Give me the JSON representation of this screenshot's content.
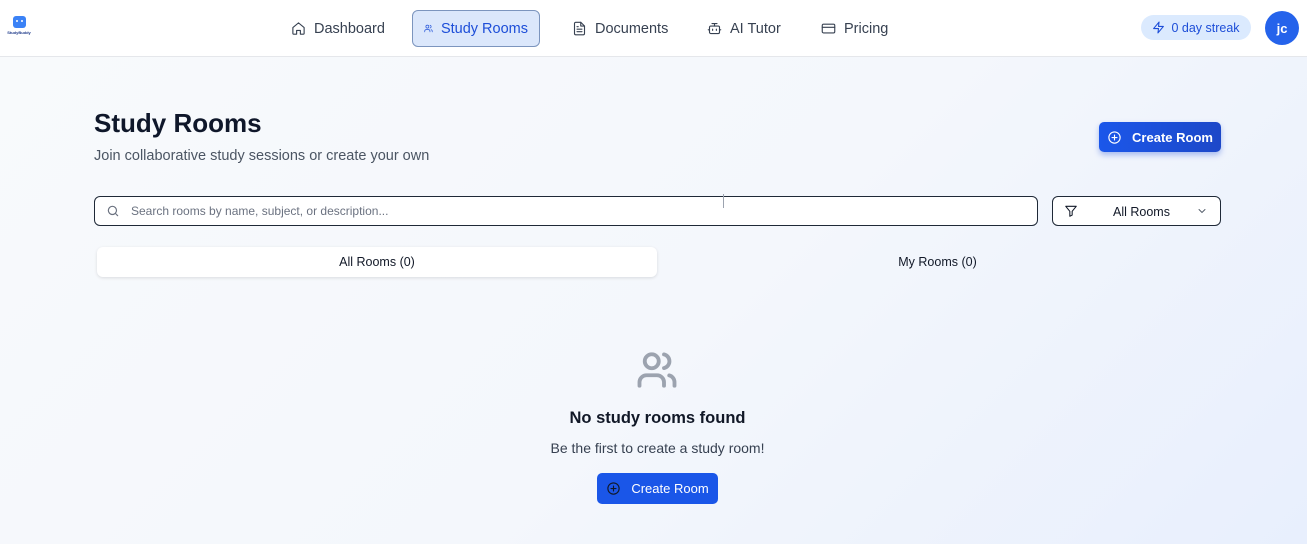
{
  "app": {
    "logo_text": "StudyBuddy"
  },
  "nav": {
    "items": [
      {
        "label": "Dashboard",
        "icon": "home-icon"
      },
      {
        "label": "Study Rooms",
        "icon": "users-icon",
        "active": true
      },
      {
        "label": "Documents",
        "icon": "file-icon"
      },
      {
        "label": "AI Tutor",
        "icon": "bot-icon"
      },
      {
        "label": "Pricing",
        "icon": "credit-card-icon"
      }
    ]
  },
  "streak": {
    "label": "0 day streak",
    "icon": "lightning-icon"
  },
  "user": {
    "initials": "jc"
  },
  "page": {
    "title": "Study Rooms",
    "subtitle": "Join collaborative study sessions or create your own",
    "create_button": "Create Room"
  },
  "search": {
    "placeholder": "Search rooms by name, subject, or description...",
    "value": ""
  },
  "filter": {
    "selected": "All Rooms"
  },
  "tabs": [
    {
      "label": "All Rooms (0)",
      "active": true
    },
    {
      "label": "My Rooms (0)",
      "active": false
    }
  ],
  "empty_state": {
    "title": "No study rooms found",
    "subtitle": "Be the first to create a study room!",
    "button": "Create Room"
  },
  "colors": {
    "primary": "#1a56e8",
    "active_nav_bg": "#dbe7fb",
    "streak_bg": "#dbeafe"
  }
}
